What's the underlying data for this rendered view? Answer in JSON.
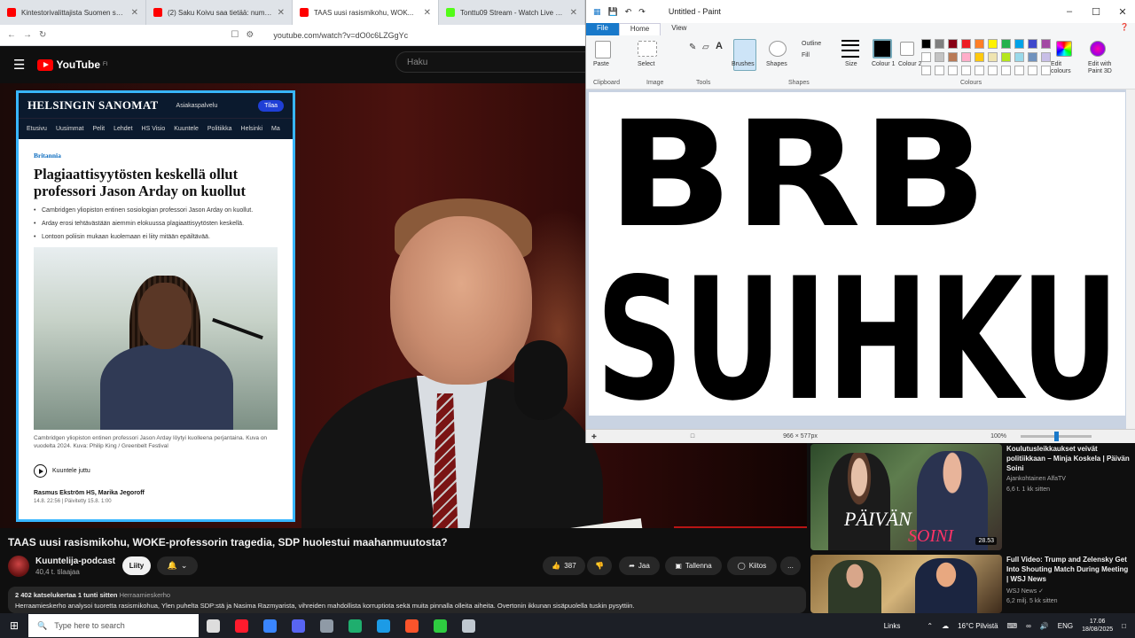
{
  "browser": {
    "tabs": [
      {
        "label": "Kintestorivalittajista Suomen suosi...",
        "favicon_color": "#ff0000",
        "active": false
      },
      {
        "label": "(2) Saku Koivu saa tietää: numero...",
        "favicon_color": "#ff0000",
        "active": false
      },
      {
        "label": "TAAS uusi rasismikohu, WOK...",
        "favicon_color": "#ff0000",
        "active": true
      },
      {
        "label": "Tonttu09 Stream - Watch Live on Kick",
        "favicon_color": "#53fc18",
        "active": false
      }
    ],
    "url": "youtube.com/watch?v=dO0c6LZGgYc"
  },
  "youtube": {
    "logo_text": "YouTube",
    "logo_region": "FI",
    "search_placeholder": "Haku"
  },
  "article": {
    "brand": "HELSINGIN SANOMAT",
    "top_link": "Asiakaspalvelu",
    "subscribe_label": "Tilaa",
    "nav": [
      "Etusivu",
      "Uusimmat",
      "Pelit",
      "Lehdet",
      "HS Visio",
      "Kuuntele",
      "Politiikka",
      "Helsinki",
      "Ma"
    ],
    "section": "Britannia",
    "title": "Plagiaattisyytösten keskellä ollut professori Jason Arday on kuollut",
    "bullets": [
      "Cambridgen yliopiston entinen sosiologian professori Jason Arday on kuollut.",
      "Arday erosi tehtävästään aiemmin elokuussa plagiaattisyytösten keskellä.",
      "Lontoon poliisin mukaan kuolemaan ei liity mitään epäiltävää."
    ],
    "caption": "Cambridgen yliopiston entinen professori Jason Arday löytyi kuolleena perjantaina. Kuva on vuodelta 2024. Kuva: Philip King / Greenbelt Festival",
    "listen_label": "Kuuntele juttu",
    "authors": "Rasmus Ekström HS, Marika Jegoroff",
    "date": "14.8. 22:56 | Päivitetty 15.8. 1:00"
  },
  "paint": {
    "window_title": "Untitled - Paint",
    "menu": {
      "file": "File",
      "home": "Home",
      "view": "View"
    },
    "groups": [
      "Clipboard",
      "Image",
      "Tools",
      "Shapes",
      "Colours"
    ],
    "tool_labels": {
      "paste": "Paste",
      "select": "Select",
      "brushes": "Brushes",
      "shapes": "Shapes",
      "outline": "Outline",
      "fill": "Fill",
      "size": "Size",
      "colour1": "Colour 1",
      "colour2": "Colour 2",
      "edit_colours": "Edit colours",
      "edit_3d": "Edit with Paint 3D"
    },
    "palette": [
      "#000000",
      "#7f7f7f",
      "#880015",
      "#ed1c24",
      "#ff7f27",
      "#fff200",
      "#22b14c",
      "#00a2e8",
      "#3f48cc",
      "#a349a4",
      "#ffffff",
      "#c3c3c3",
      "#b97a57",
      "#ffaec9",
      "#ffc90e",
      "#efe4b0",
      "#b5e61d",
      "#99d9ea",
      "#7092be",
      "#c8bfe7"
    ],
    "canvas_text_line1": "BRB",
    "canvas_text_line2": "SUIHKU",
    "canvas_size": "966 × 577px",
    "zoom": "100%"
  },
  "video": {
    "title": "TAAS uusi rasismikohu, WOKE-professorin tragedia, SDP huolestui maahanmuutosta?",
    "channel": "Kuuntelija-podcast",
    "subscribers": "40,4 t. tilaajaa",
    "join_label": "Liity",
    "likes": "387",
    "share_label": "Jaa",
    "save_label": "Tallenna",
    "thanks_label": "Kiitos",
    "more_label": "...",
    "desc_meta": "2 402 katselukertaa  1 tunti sitten",
    "desc_tag": "Herraamieskerho",
    "desc_text": "Herraamieskerho analysoi tuoretta rasismikohua, Ylen puhelta SDP:stä ja Nasima Razmyarista, vihreiden mahdollista korruptiota sekä muita pinnalla olleita aiheita. Overtonin ikkunan sisäpuolella tuskin pysyttiin."
  },
  "recommendations": [
    {
      "title": "Koulutusleikkaukset veivät politiikkaan – Minja Koskela | Päivän Soini",
      "channel": "Ajankohtainen AlfaTV",
      "meta": "6,6 t.  1 kk sitten",
      "thumb_text_1": "PÄIVÄN",
      "thumb_text_2": "SOINI",
      "duration": "28.53"
    },
    {
      "title": "Full Video: Trump and Zelensky Get Into Shouting Match During Meeting | WSJ News",
      "channel": "WSJ News ✓",
      "meta": "6,2 milj.  5 kk sitten"
    }
  ],
  "taskbar": {
    "search_placeholder": "Type here to search",
    "links_label": "Links",
    "weather": "16°C  Pilvistä",
    "lang": "ENG",
    "time": "17.06",
    "date": "18/08/2025",
    "apps": [
      {
        "name": "task-view-icon",
        "color": "#dddddd"
      },
      {
        "name": "opera-icon",
        "color": "#ff1b2d"
      },
      {
        "name": "files-icon",
        "color": "#3a86ff"
      },
      {
        "name": "discord-icon",
        "color": "#5865f2"
      },
      {
        "name": "shield-app-icon",
        "color": "#8f9aa6"
      },
      {
        "name": "green-app-icon",
        "color": "#1fae6e"
      },
      {
        "name": "edge-icon",
        "color": "#1c9be6"
      },
      {
        "name": "brave-icon",
        "color": "#fb542b"
      },
      {
        "name": "media-player-icon",
        "color": "#2ecc40"
      },
      {
        "name": "paint-icon",
        "color": "#c0c8d0"
      }
    ]
  }
}
